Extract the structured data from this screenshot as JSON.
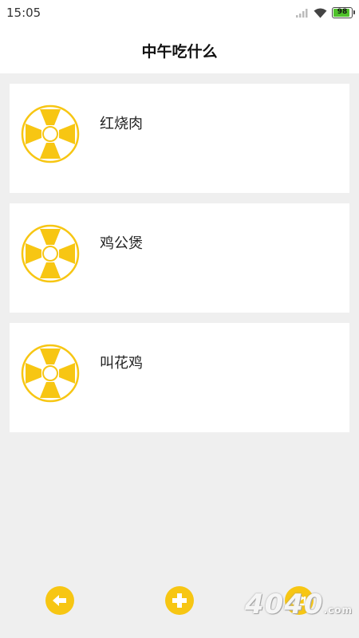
{
  "status_bar": {
    "time": "15:05",
    "battery": "98",
    "icons": [
      "signal-icon",
      "wifi-icon",
      "battery-icon"
    ]
  },
  "header": {
    "title": "中午吃什么"
  },
  "items": [
    {
      "label": "红烧肉",
      "icon": "wheel-icon"
    },
    {
      "label": "鸡公煲",
      "icon": "wheel-icon"
    },
    {
      "label": "叫花鸡",
      "icon": "wheel-icon"
    }
  ],
  "toolbar": {
    "buttons": [
      "back-icon",
      "add-icon",
      "share-icon"
    ]
  },
  "watermark": {
    "text": "4040",
    "suffix": ".com"
  },
  "colors": {
    "accent": "#f7c613",
    "background": "#efefef",
    "card": "#ffffff",
    "battery_fill": "#4fc22b"
  }
}
